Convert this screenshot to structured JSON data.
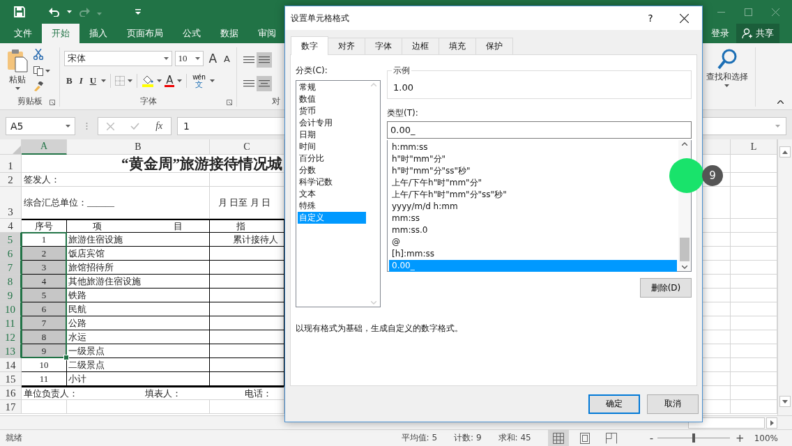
{
  "title_bar": {
    "tabs": [
      {
        "label": "文件",
        "selected": false
      },
      {
        "label": "开始",
        "selected": true
      },
      {
        "label": "插入",
        "selected": false
      },
      {
        "label": "页面布局",
        "selected": false
      },
      {
        "label": "公式",
        "selected": false
      },
      {
        "label": "数据",
        "selected": false
      },
      {
        "label": "审阅",
        "selected": false
      }
    ],
    "sign_in": "登录",
    "share": "共享"
  },
  "ribbon": {
    "paste": "粘贴",
    "clipboard_group": "剪贴板",
    "font_name": "宋体",
    "font_size": "10",
    "grow_font": "A",
    "shrink_font": "A",
    "bold": "B",
    "italic": "I",
    "underline": "U",
    "font_color": "A",
    "phonetic": "wén",
    "phonetic_char": "文",
    "font_group": "字体",
    "alignment_group": "对",
    "find_select": "查找和选择"
  },
  "formula_bar": {
    "name_box": "A5",
    "function_label": "fx",
    "formula": "1"
  },
  "sheet": {
    "columns": [
      {
        "label": "A",
        "selected": true
      },
      {
        "label": "B",
        "selected": false
      },
      {
        "label": "C",
        "selected": false
      },
      {
        "label": "L",
        "selected": false
      }
    ],
    "rows": [
      {
        "number": "1",
        "selected": false,
        "kind": "title",
        "title": "“黄金周”旅游接待情况城"
      },
      {
        "number": "2",
        "selected": false,
        "kind": "text",
        "a": "签发人："
      },
      {
        "number": "3",
        "selected": false,
        "kind": "unit",
        "a": "综合汇总单位：______",
        "c": "月 日至 月 日"
      },
      {
        "number": "4",
        "selected": false,
        "kind": "header",
        "a": "序号",
        "b": [
          "项",
          "目"
        ],
        "c": "指"
      },
      {
        "number": "5",
        "selected": true,
        "active": true,
        "kind": "item",
        "a": "1",
        "b": "旅游住宿设施",
        "c": "累计接待人"
      },
      {
        "number": "6",
        "selected": true,
        "active": false,
        "kind": "item",
        "a": "2",
        "b": "饭店宾馆"
      },
      {
        "number": "7",
        "selected": true,
        "active": false,
        "kind": "item",
        "a": "3",
        "b": "旅馆招待所"
      },
      {
        "number": "8",
        "selected": true,
        "active": false,
        "kind": "item",
        "a": "4",
        "b": "其他旅游住宿设施"
      },
      {
        "number": "9",
        "selected": true,
        "active": false,
        "kind": "item",
        "a": "5",
        "b": "铁路"
      },
      {
        "number": "10",
        "selected": true,
        "active": false,
        "kind": "item",
        "a": "6",
        "b": "民航"
      },
      {
        "number": "11",
        "selected": true,
        "active": false,
        "kind": "item",
        "a": "7",
        "b": "公路"
      },
      {
        "number": "12",
        "selected": true,
        "active": false,
        "kind": "item",
        "a": "8",
        "b": "水运"
      },
      {
        "number": "13",
        "selected": true,
        "active": false,
        "kind": "item",
        "a": "9",
        "b": "一级景点"
      },
      {
        "number": "14",
        "selected": false,
        "kind": "item",
        "a": "10",
        "b": "二级景点"
      },
      {
        "number": "15",
        "selected": false,
        "kind": "item",
        "a": "11",
        "b": "小计"
      },
      {
        "number": "16",
        "selected": false,
        "kind": "footer",
        "a": "单位负责人：",
        "b": "填表人：",
        "c": "电话："
      },
      {
        "number": "17",
        "selected": false,
        "kind": "blank"
      }
    ]
  },
  "dialog": {
    "title": "设置单元格格式",
    "help": "?",
    "tabs": [
      {
        "label": "数字",
        "selected": true
      },
      {
        "label": "对齐",
        "selected": false
      },
      {
        "label": "字体",
        "selected": false
      },
      {
        "label": "边框",
        "selected": false
      },
      {
        "label": "填充",
        "selected": false
      },
      {
        "label": "保护",
        "selected": false
      }
    ],
    "category_label": "分类(C):",
    "categories": [
      {
        "label": "常规",
        "selected": false
      },
      {
        "label": "数值",
        "selected": false
      },
      {
        "label": "货币",
        "selected": false
      },
      {
        "label": "会计专用",
        "selected": false
      },
      {
        "label": "日期",
        "selected": false
      },
      {
        "label": "时间",
        "selected": false
      },
      {
        "label": "百分比",
        "selected": false
      },
      {
        "label": "分数",
        "selected": false
      },
      {
        "label": "科学记数",
        "selected": false
      },
      {
        "label": "文本",
        "selected": false
      },
      {
        "label": "特殊",
        "selected": false
      },
      {
        "label": "自定义",
        "selected": true
      }
    ],
    "sample": {
      "label": "示例",
      "value": "1.00"
    },
    "type_label": "类型(T):",
    "type_value": "0.00_",
    "formats": [
      {
        "label": "h:mm:ss",
        "selected": false
      },
      {
        "label": "h\"时\"mm\"分\"",
        "selected": false
      },
      {
        "label": "h\"时\"mm\"分\"ss\"秒\"",
        "selected": false
      },
      {
        "label": "上午/下午h\"时\"mm\"分\"",
        "selected": false
      },
      {
        "label": "上午/下午h\"时\"mm\"分\"ss\"秒\"",
        "selected": false
      },
      {
        "label": "yyyy/m/d h:mm",
        "selected": false
      },
      {
        "label": "mm:ss",
        "selected": false
      },
      {
        "label": "mm:ss.0",
        "selected": false
      },
      {
        "label": "@",
        "selected": false
      },
      {
        "label": "[h]:mm:ss",
        "selected": false
      },
      {
        "label": "0.00_",
        "selected": true
      }
    ],
    "delete_button": "删除(D)",
    "description": "以现有格式为基础，生成自定义的数字格式。",
    "ok": "确定",
    "cancel": "取消"
  },
  "click_marker": {
    "step": "9"
  },
  "status_bar": {
    "ready": "就绪",
    "average": "平均值: 5",
    "count": "计数: 9",
    "sum": "求和: 45",
    "views": [
      {
        "kind": "normal",
        "selected": true
      },
      {
        "kind": "page_layout",
        "selected": false
      },
      {
        "kind": "page_break",
        "selected": false
      }
    ],
    "zoom": {
      "minus": "-",
      "plus": "+",
      "level": 0.5,
      "value": "100%"
    }
  }
}
